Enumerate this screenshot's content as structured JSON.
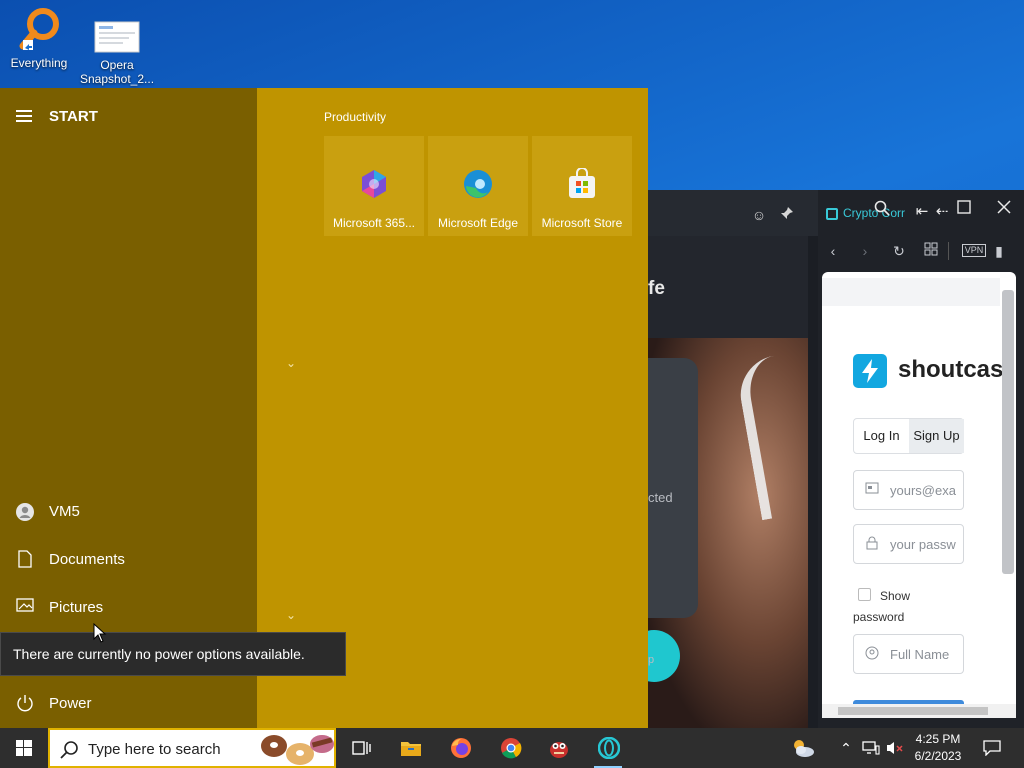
{
  "desktop": {
    "icons": [
      {
        "label": "Everything"
      },
      {
        "label": "Opera\nSnapshot_2..."
      }
    ]
  },
  "start_menu": {
    "title": "START",
    "nav": [
      {
        "label": "VM5",
        "icon": "user-icon"
      },
      {
        "label": "Documents",
        "icon": "document-icon"
      },
      {
        "label": "Pictures",
        "icon": "pictures-icon"
      },
      {
        "label": "Power",
        "icon": "power-icon"
      }
    ],
    "group_title": "Productivity",
    "tiles": [
      {
        "label": "Microsoft 365...",
        "icon": "microsoft-365-icon"
      },
      {
        "label": "Microsoft Edge",
        "icon": "edge-icon"
      },
      {
        "label": "Microsoft Store",
        "icon": "store-icon"
      }
    ],
    "tooltip": "There are currently no power options available."
  },
  "opera": {
    "fragment_heading": "fe",
    "fragment_status": "cted",
    "fragment_small": "p",
    "panel_title": "Crypto Corr",
    "toolbar": {
      "vpn_label": "VPN"
    },
    "page": {
      "logo_text": "shoutcas",
      "login_tab": "Log In",
      "signup_tab": "Sign Up",
      "email_placeholder": "yours@exa",
      "password_placeholder": "your passw",
      "show_password": "Show password",
      "fullname_placeholder": "Full Name"
    }
  },
  "taskbar": {
    "search_placeholder": "Type here to search",
    "apps": [
      "task-view-icon",
      "file-explorer-icon",
      "firefox-icon",
      "chrome-icon",
      "game-app-icon",
      "opera-icon"
    ],
    "clock_time": "4:25 PM",
    "clock_date": "6/2/2023"
  },
  "colors": {
    "start_left": "#7a5f00",
    "start_right": "#bf9400",
    "tile": "#c9a010",
    "accent_teal": "#1fc7cf"
  }
}
